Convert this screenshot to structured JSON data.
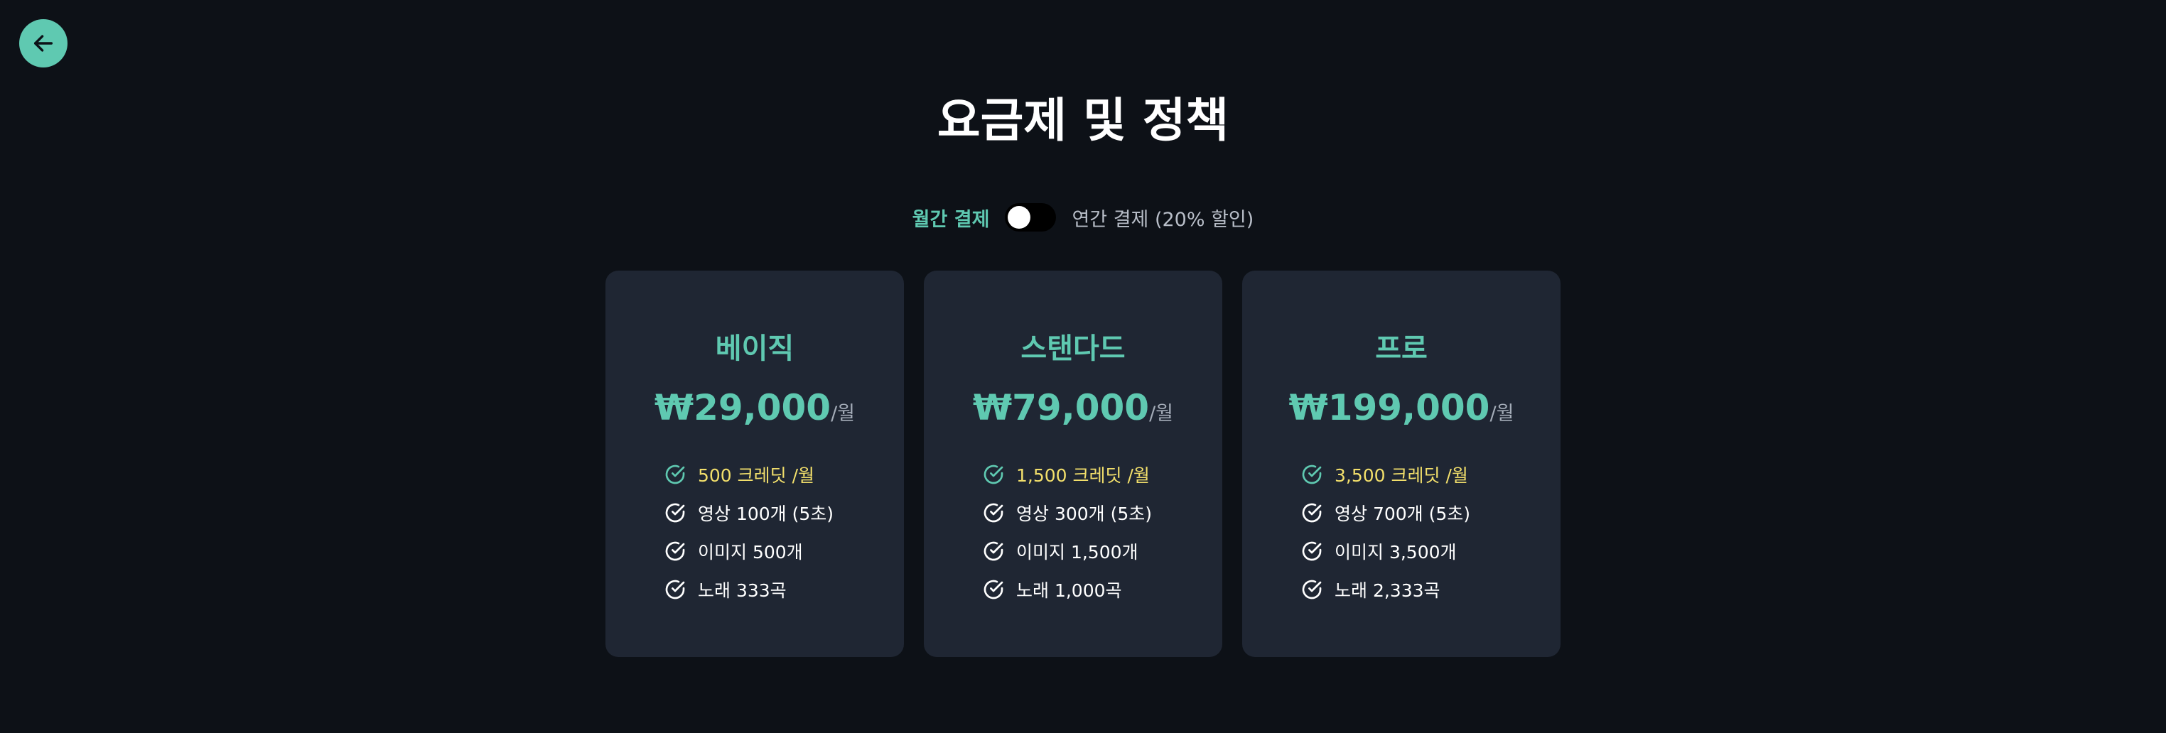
{
  "title": "요금제 및 정책",
  "billing": {
    "monthly_label": "월간 결제",
    "yearly_label": "연간 결제 (20% 할인)",
    "selected": "monthly"
  },
  "colors": {
    "background": "#0d1117",
    "card": "#1f2633",
    "accent": "#5fc9b1",
    "highlight": "#f2df6b"
  },
  "icons": {
    "back": "arrow-left-icon",
    "feature": "check-circle-icon"
  },
  "plans": [
    {
      "name": "베이직",
      "price": "₩29,000",
      "unit": "/월",
      "features": [
        "500 크레딧 /월",
        "영상 100개 (5초)",
        "이미지 500개",
        "노래 333곡"
      ]
    },
    {
      "name": "스탠다드",
      "price": "₩79,000",
      "unit": "/월",
      "features": [
        "1,500 크레딧 /월",
        "영상 300개 (5초)",
        "이미지 1,500개",
        "노래 1,000곡"
      ]
    },
    {
      "name": "프로",
      "price": "₩199,000",
      "unit": "/월",
      "features": [
        "3,500 크레딧 /월",
        "영상 700개 (5초)",
        "이미지 3,500개",
        "노래 2,333곡"
      ]
    }
  ]
}
